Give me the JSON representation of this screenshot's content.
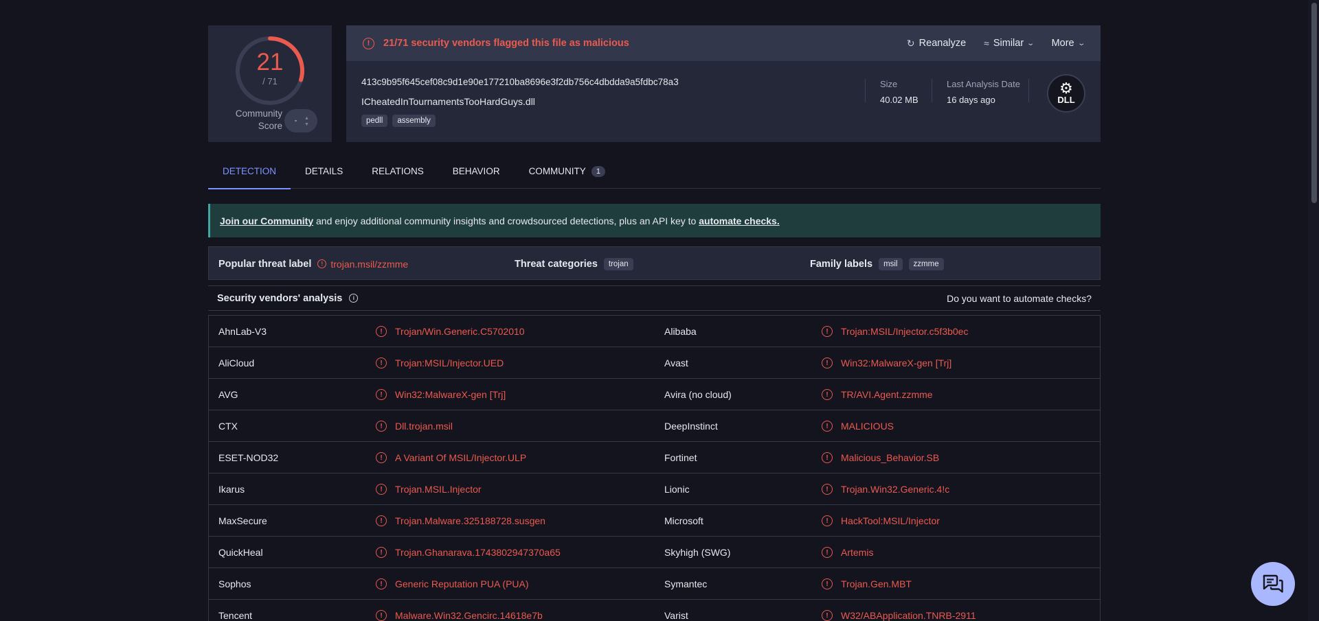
{
  "score": {
    "detections": "21",
    "total": "/ 71",
    "ratio": 0.296,
    "community_label": "Community Score"
  },
  "alert": {
    "text": "21/71 security vendors flagged this file as malicious"
  },
  "actions": {
    "reanalyze": "Reanalyze",
    "similar": "Similar",
    "more": "More"
  },
  "file": {
    "hash": "413c9b95f645cef08c9d1e90e177210ba8696e3f2db756c4dbdda9a5fdbc78a3",
    "name": "ICheatedInTournamentsTooHardGuys.dll",
    "tags": [
      "pedll",
      "assembly"
    ],
    "size_label": "Size",
    "size_value": "40.02 MB",
    "date_label": "Last Analysis Date",
    "date_value": "16 days ago",
    "type_badge": "DLL"
  },
  "tabs": [
    {
      "label": "DETECTION"
    },
    {
      "label": "DETAILS"
    },
    {
      "label": "RELATIONS"
    },
    {
      "label": "BEHAVIOR"
    },
    {
      "label": "COMMUNITY",
      "count": "1"
    }
  ],
  "banner": {
    "join": "Join our Community",
    "middle": " and enjoy additional community insights and crowdsourced detections, plus an API key to ",
    "automate": "automate checks."
  },
  "threat": {
    "popular_label": "Popular threat label",
    "popular_value": "trojan.msil/zzmme",
    "categories_label": "Threat categories",
    "categories": [
      "trojan"
    ],
    "family_label": "Family labels",
    "families": [
      "msil",
      "zzmme"
    ]
  },
  "vendors": {
    "title": "Security vendors' analysis",
    "automate": "Do you want to automate checks?",
    "rows": [
      {
        "left_vendor": "AhnLab-V3",
        "left_result": "Trojan/Win.Generic.C5702010",
        "right_vendor": "Alibaba",
        "right_result": "Trojan:MSIL/Injector.c5f3b0ec"
      },
      {
        "left_vendor": "AliCloud",
        "left_result": "Trojan:MSIL/Injector.UED",
        "right_vendor": "Avast",
        "right_result": "Win32:MalwareX-gen [Trj]"
      },
      {
        "left_vendor": "AVG",
        "left_result": "Win32:MalwareX-gen [Trj]",
        "right_vendor": "Avira (no cloud)",
        "right_result": "TR/AVI.Agent.zzmme"
      },
      {
        "left_vendor": "CTX",
        "left_result": "Dll.trojan.msil",
        "right_vendor": "DeepInstinct",
        "right_result": "MALICIOUS"
      },
      {
        "left_vendor": "ESET-NOD32",
        "left_result": "A Variant Of MSIL/Injector.ULP",
        "right_vendor": "Fortinet",
        "right_result": "Malicious_Behavior.SB"
      },
      {
        "left_vendor": "Ikarus",
        "left_result": "Trojan.MSIL.Injector",
        "right_vendor": "Lionic",
        "right_result": "Trojan.Win32.Generic.4!c"
      },
      {
        "left_vendor": "MaxSecure",
        "left_result": "Trojan.Malware.325188728.susgen",
        "right_vendor": "Microsoft",
        "right_result": "HackTool:MSIL/Injector"
      },
      {
        "left_vendor": "QuickHeal",
        "left_result": "Trojan.Ghanarava.1743802947370a65",
        "right_vendor": "Skyhigh (SWG)",
        "right_result": "Artemis"
      },
      {
        "left_vendor": "Sophos",
        "left_result": "Generic Reputation PUA (PUA)",
        "right_vendor": "Symantec",
        "right_result": "Trojan.Gen.MBT"
      },
      {
        "left_vendor": "Tencent",
        "left_result": "Malware.Win32.Gencirc.14618e7b",
        "right_vendor": "Varist",
        "right_result": "W32/ABApplication.TNRB-2911"
      }
    ]
  },
  "colors": {
    "malicious": "#ea5a4f",
    "accent": "#7d93ff",
    "background": "#14141f",
    "card": "#252838",
    "banner": "#1f3d3d"
  },
  "icons": {
    "alert": "exclamation-circle-icon",
    "reanalyze": "refresh-icon",
    "similar": "similar-icon",
    "more": "chevron-down-icon",
    "file_type": "dll-gear-icon",
    "chat": "chat-icon"
  }
}
